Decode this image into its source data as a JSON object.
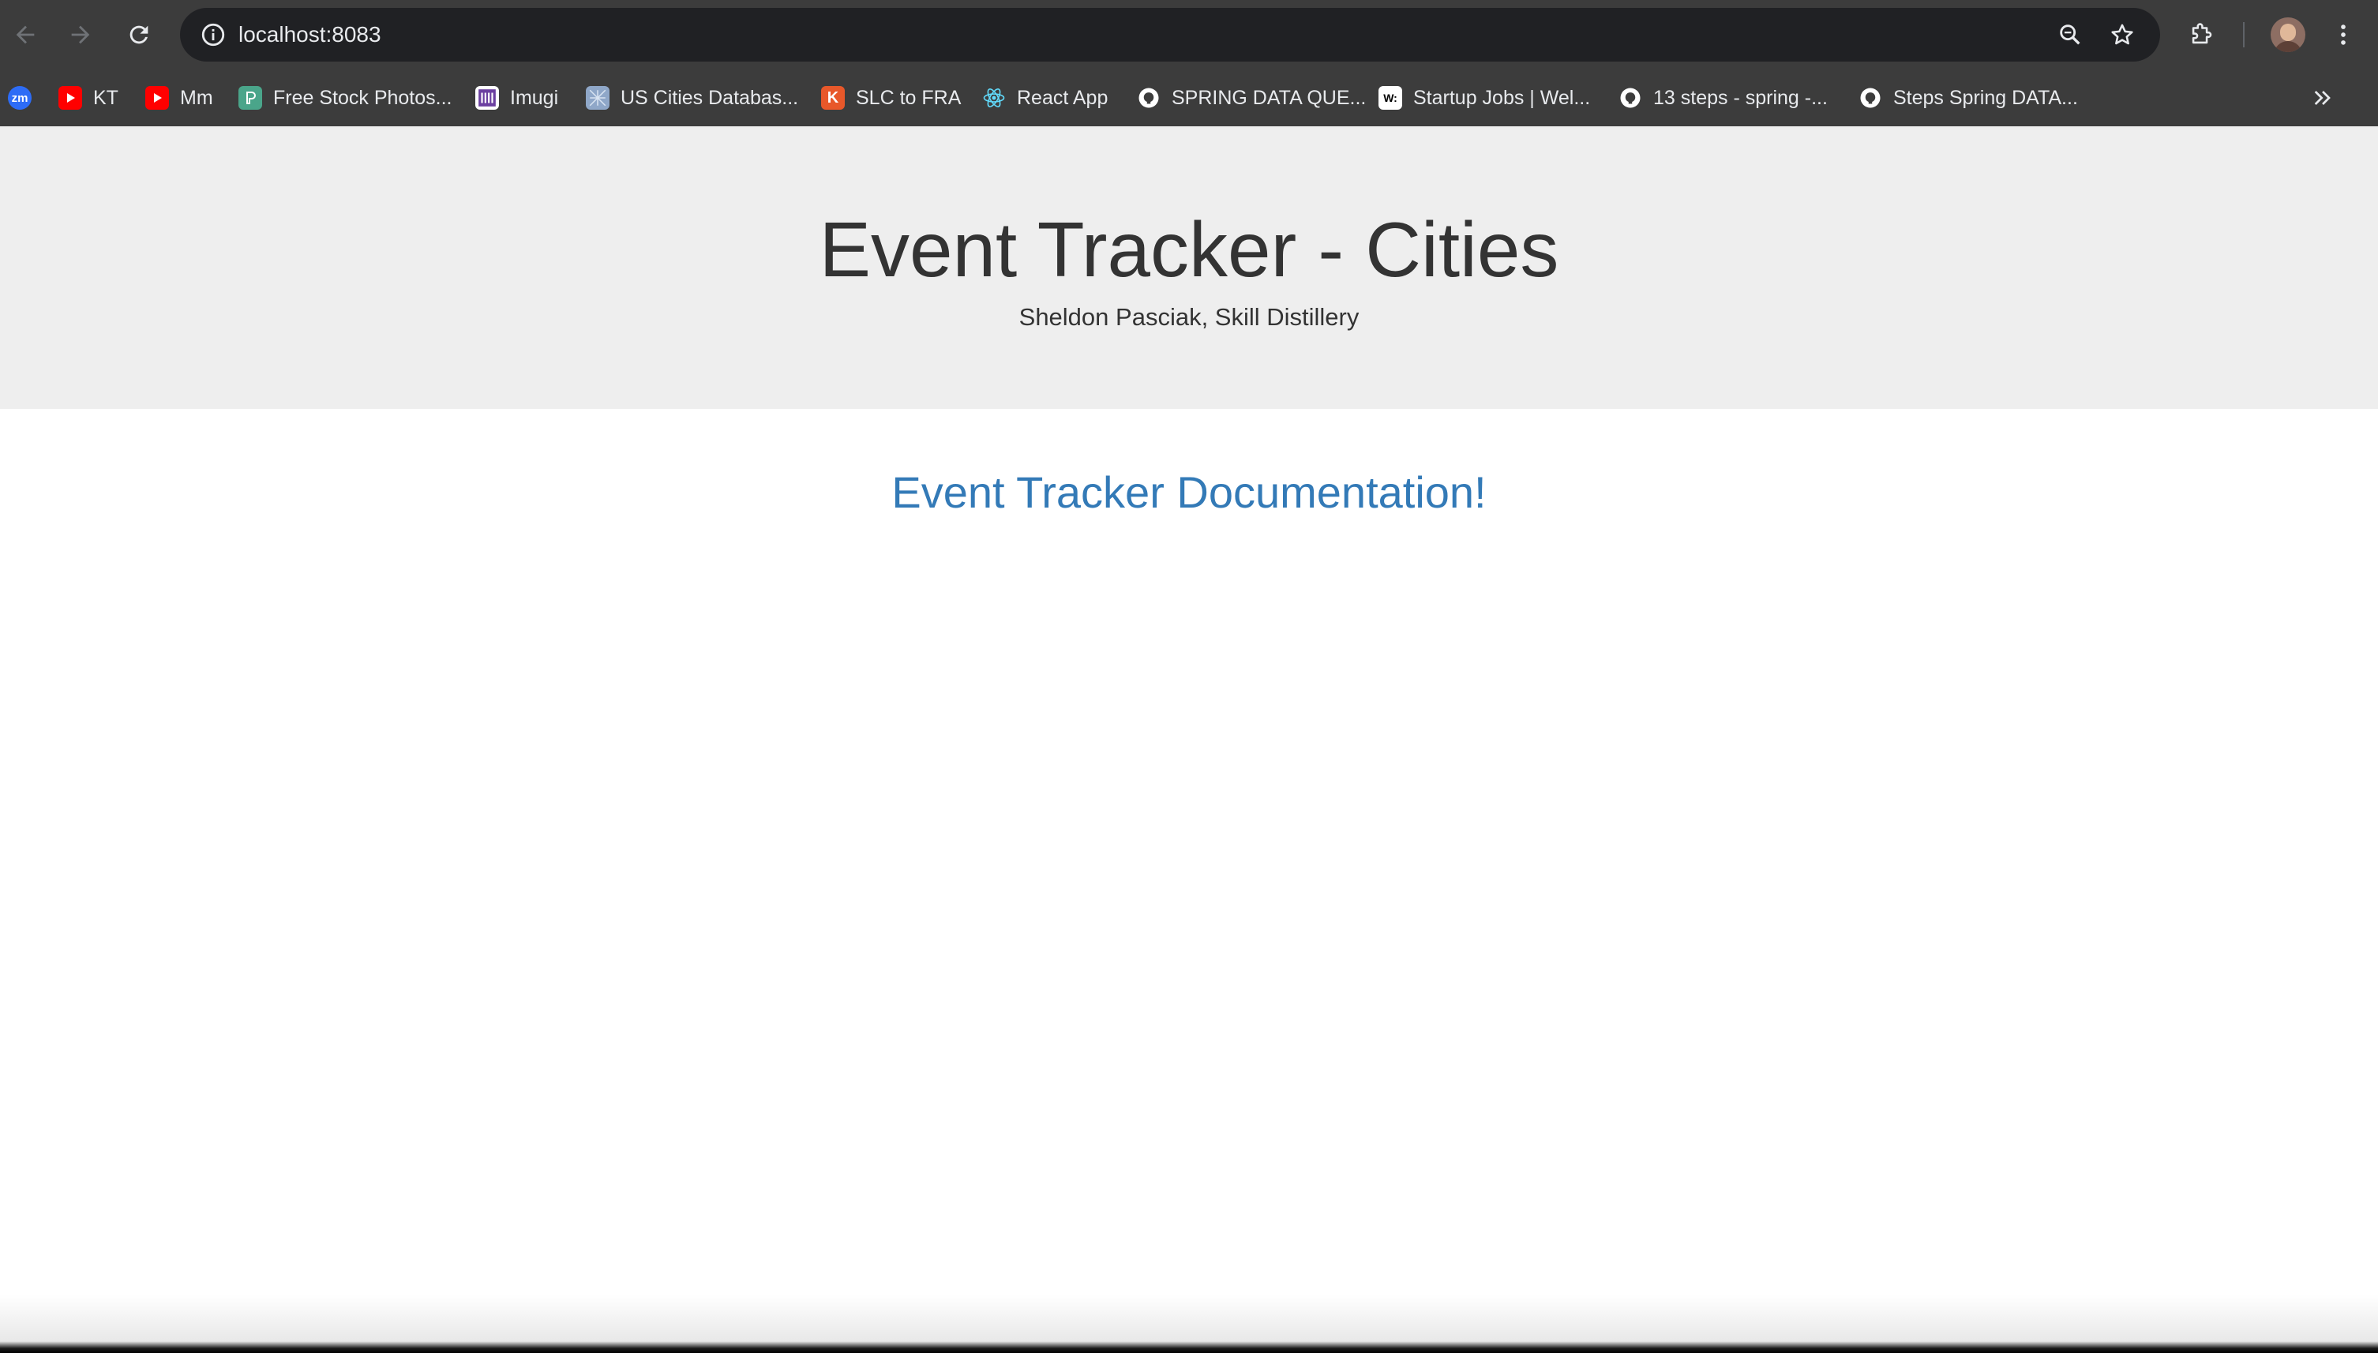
{
  "browser": {
    "url": "localhost:8083",
    "icons": {
      "back": "back-arrow-icon",
      "forward": "forward-arrow-icon",
      "reload": "reload-icon",
      "site_info": "info-icon",
      "zoom": "zoom-icon",
      "bookmark": "star-icon",
      "extensions": "puzzle-icon",
      "menu": "kebab-menu-icon"
    },
    "bookmarks": [
      {
        "label": "",
        "icon": "zoom-icon"
      },
      {
        "label": "KT",
        "icon": "youtube-icon"
      },
      {
        "label": "Mm",
        "icon": "youtube-icon"
      },
      {
        "label": "Free Stock Photos...",
        "icon": "stock-photo-icon"
      },
      {
        "label": "Imugi",
        "icon": "imugi-icon"
      },
      {
        "label": "US Cities Databas...",
        "icon": "map-icon"
      },
      {
        "label": "SLC to FRA",
        "icon": "kayak-icon"
      },
      {
        "label": "React App",
        "icon": "react-icon"
      },
      {
        "label": "SPRING DATA QUE...",
        "icon": "github-icon"
      },
      {
        "label": "Startup Jobs | Wel...",
        "icon": "wellfound-icon"
      },
      {
        "label": "13 steps - spring -...",
        "icon": "github-icon"
      },
      {
        "label": "Steps Spring DATA...",
        "icon": "github-icon"
      }
    ],
    "zoom_badge": "zm",
    "wellfound_badge": "W:",
    "kayak_badge": "K"
  },
  "page": {
    "title": "Event Tracker - Cities",
    "subtitle": "Sheldon Pasciak, Skill Distillery",
    "heading": "Event Tracker Documentation!"
  },
  "colors": {
    "chrome": "#3c3c3c",
    "omnibox": "#202124",
    "jumbotron": "#eeeeee",
    "heading_link": "#337ab7",
    "title_text": "#333333"
  }
}
